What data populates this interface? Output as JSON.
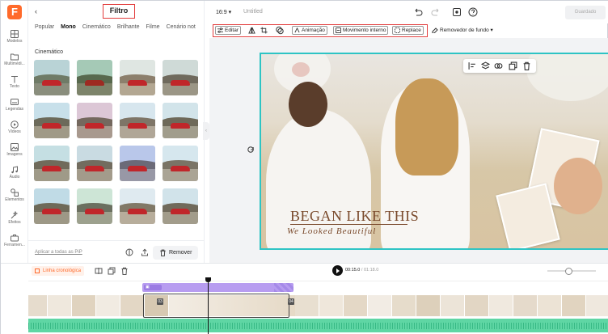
{
  "app": {
    "logo_letter": "F",
    "accent": "#ff6a2b"
  },
  "rail": [
    {
      "label": "Modelos",
      "icon": "grid-icon"
    },
    {
      "label": "Multimédi...",
      "icon": "folder-icon"
    },
    {
      "label": "Texto",
      "icon": "text-icon"
    },
    {
      "label": "Legendas",
      "icon": "captions-icon"
    },
    {
      "label": "Vídeos",
      "icon": "video-icon"
    },
    {
      "label": "Imagens",
      "icon": "image-icon"
    },
    {
      "label": "Áudio",
      "icon": "music-icon"
    },
    {
      "label": "Elementos",
      "icon": "shapes-icon"
    },
    {
      "label": "Efeitos",
      "icon": "effects-icon"
    },
    {
      "label": "Ferramen...",
      "icon": "toolbox-icon"
    }
  ],
  "panel": {
    "title": "Filtro",
    "tabs": [
      "Popular",
      "Mono",
      "Cinemático",
      "Brilhante",
      "Filme",
      "Cenário not"
    ],
    "active_tab": "Mono",
    "section": "Cinemático",
    "apply_all": "Aplicar a todas as PiP",
    "remove_label": "Remover"
  },
  "topbar": {
    "ratio": "16:9",
    "title": "Untitled",
    "saved_label": "Guardado"
  },
  "toolbar": {
    "edit": "Editar",
    "animation": "Animação",
    "inner_motion": "Movimento interno",
    "replace": "Replace",
    "bg_remover": "Removedor de fundo"
  },
  "canvas": {
    "title_text": "BEGAN LIKE THIS",
    "subtitle_text": "We Looked Beautiful"
  },
  "timeline": {
    "label": "Linha cronológica",
    "current_time": "00:15.0",
    "total_time": "/ 01:18.0",
    "clip_left_num": "03",
    "clip_right_num": "04"
  }
}
